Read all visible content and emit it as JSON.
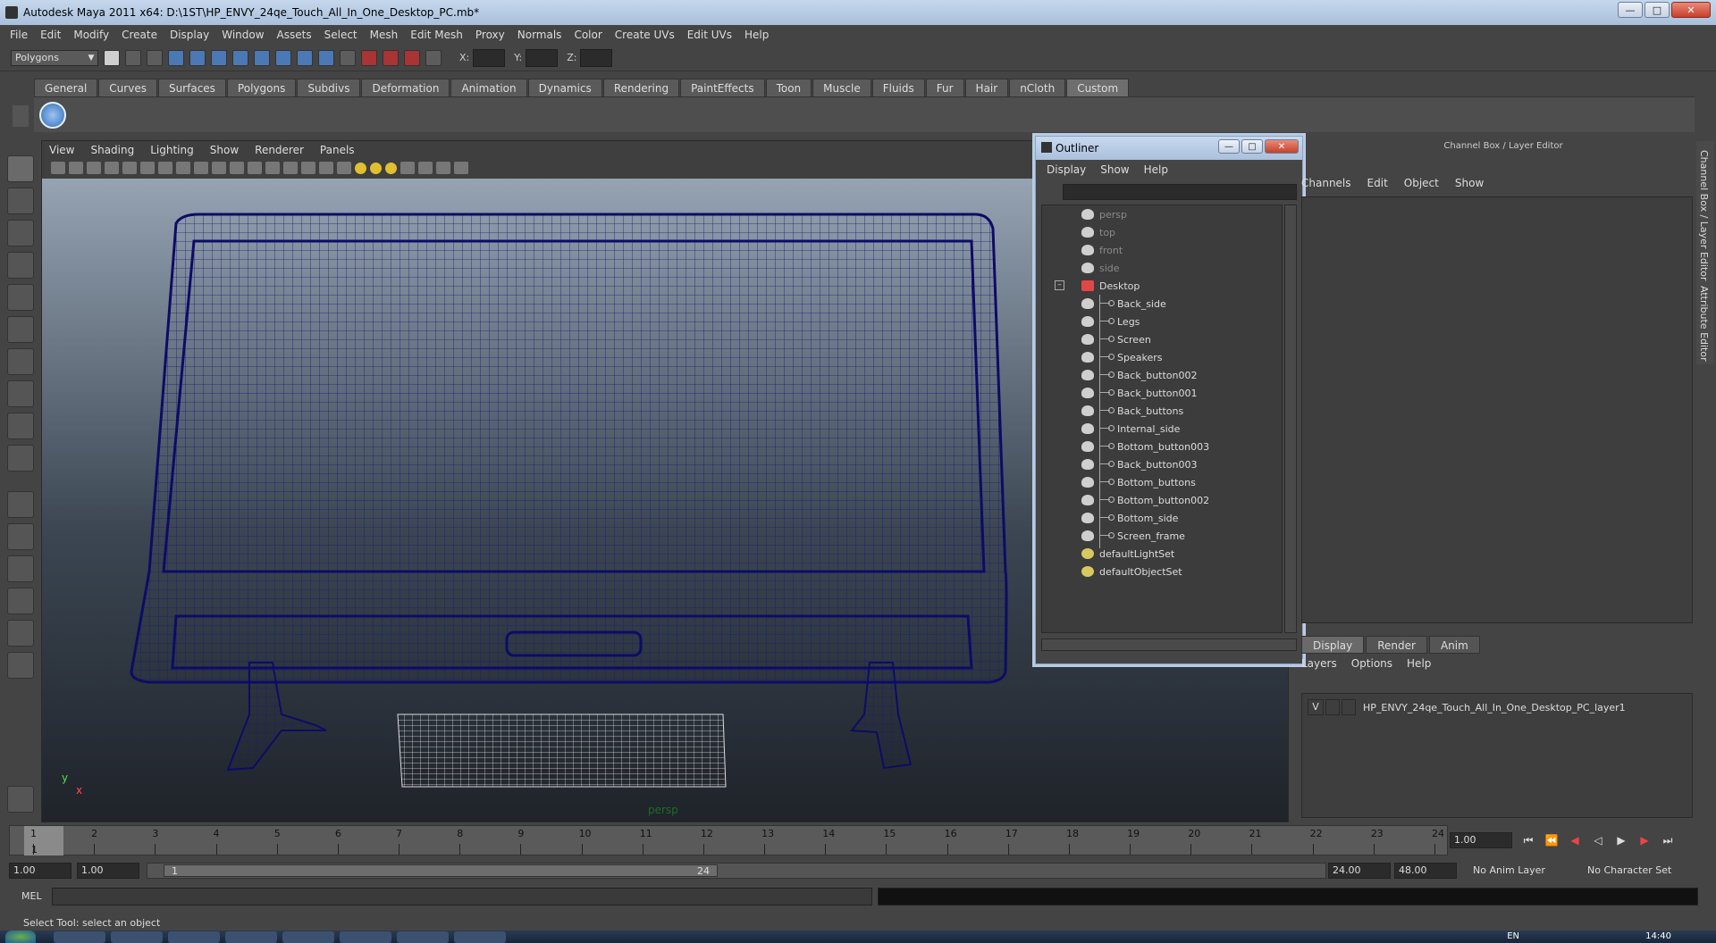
{
  "window": {
    "title": "Autodesk Maya 2011 x64: D:\\1ST\\HP_ENVY_24qe_Touch_All_In_One_Desktop_PC.mb*",
    "minimize": "—",
    "maximize": "□",
    "close": "✕"
  },
  "menubar": [
    "File",
    "Edit",
    "Modify",
    "Create",
    "Display",
    "Window",
    "Assets",
    "Select",
    "Mesh",
    "Edit Mesh",
    "Proxy",
    "Normals",
    "Color",
    "Create UVs",
    "Edit UVs",
    "Help"
  ],
  "statusline": {
    "mode": "Polygons",
    "x_label": "X:",
    "y_label": "Y:",
    "z_label": "Z:"
  },
  "shelf": {
    "tabs": [
      "General",
      "Curves",
      "Surfaces",
      "Polygons",
      "Subdivs",
      "Deformation",
      "Animation",
      "Dynamics",
      "Rendering",
      "PaintEffects",
      "Toon",
      "Muscle",
      "Fluids",
      "Fur",
      "Hair",
      "nCloth",
      "Custom"
    ],
    "active_tab": "Custom"
  },
  "panel": {
    "menu": [
      "View",
      "Shading",
      "Lighting",
      "Show",
      "Renderer",
      "Panels"
    ],
    "camera_label": "persp",
    "axis_y": "y",
    "axis_x": "x"
  },
  "outliner": {
    "title": "Outliner",
    "menu": [
      "Display",
      "Show",
      "Help"
    ],
    "expander": "–",
    "cameras": [
      "persp",
      "top",
      "front",
      "side"
    ],
    "group": "Desktop",
    "children": [
      "Back_side",
      "Legs",
      "Screen",
      "Speakers",
      "Back_button002",
      "Back_button001",
      "Back_buttons",
      "Internal_side",
      "Bottom_button003",
      "Back_button003",
      "Bottom_buttons",
      "Bottom_button002",
      "Bottom_side",
      "Screen_frame"
    ],
    "sets": [
      "defaultLightSet",
      "defaultObjectSet"
    ]
  },
  "channel_box": {
    "title": "Channel Box / Layer Editor",
    "menu": [
      "Channels",
      "Edit",
      "Object",
      "Show"
    ],
    "side_tab_a": "Channel Box / Layer Editor",
    "side_tab_b": "Attribute Editor"
  },
  "layers": {
    "tabs": [
      "Display",
      "Render",
      "Anim"
    ],
    "active_tab": "Display",
    "menu": [
      "Layers",
      "Options",
      "Help"
    ],
    "layer_visibility": "V",
    "layer_name": "HP_ENVY_24qe_Touch_All_In_One_Desktop_PC_layer1"
  },
  "timeline": {
    "ticks": [
      "1",
      "2",
      "3",
      "4",
      "5",
      "6",
      "7",
      "8",
      "9",
      "10",
      "11",
      "12",
      "13",
      "14",
      "15",
      "16",
      "17",
      "18",
      "19",
      "20",
      "21",
      "22",
      "23",
      "24"
    ],
    "current_frame": "1",
    "current_frame_field": "1.00"
  },
  "range": {
    "start_time": "1.00",
    "start_playback": "1.00",
    "range_start": "1",
    "range_end": "24",
    "end_playback": "24.00",
    "end_time": "48.00",
    "anim_layer": "No Anim Layer",
    "character_set": "No Character Set"
  },
  "mel": {
    "label": "MEL"
  },
  "helpline": "Select Tool: select an object",
  "taskbar": {
    "lang": "EN",
    "clock": "14:40"
  }
}
